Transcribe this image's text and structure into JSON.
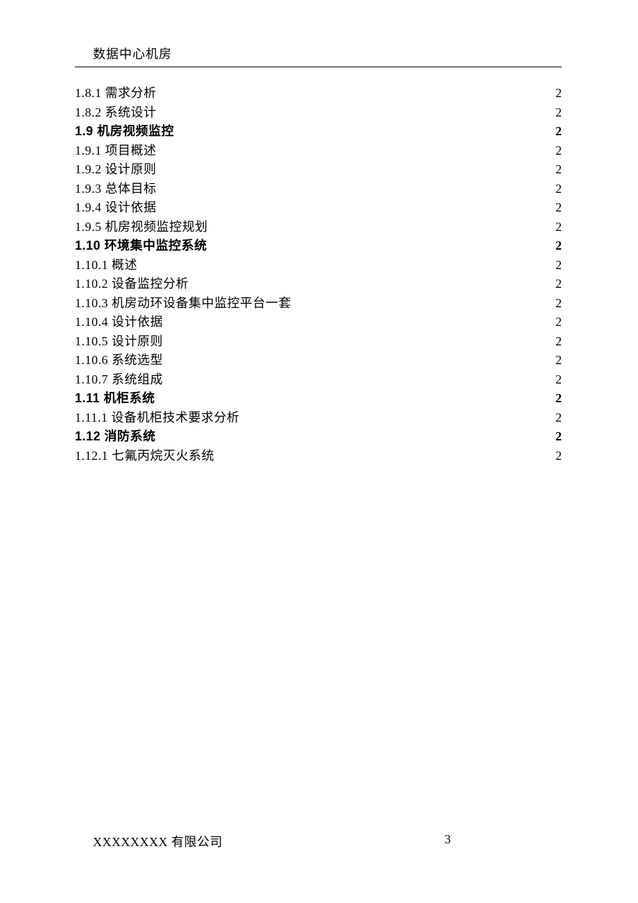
{
  "header": {
    "title": "数据中心机房"
  },
  "toc": {
    "items": [
      {
        "label": "1.8.1 需求分析",
        "page": "2",
        "bold": false
      },
      {
        "label": "1.8.2 系统设计",
        "page": "2",
        "bold": false
      },
      {
        "label": "1.9 机房视频监控",
        "page": "2",
        "bold": true
      },
      {
        "label": "1.9.1 项目概述",
        "page": "2",
        "bold": false
      },
      {
        "label": "1.9.2 设计原则",
        "page": "2",
        "bold": false
      },
      {
        "label": "1.9.3 总体目标",
        "page": "2",
        "bold": false
      },
      {
        "label": "1.9.4 设计依据",
        "page": "2",
        "bold": false
      },
      {
        "label": "1.9.5 机房视频监控规划",
        "page": "2",
        "bold": false
      },
      {
        "label": "1.10 环境集中监控系统",
        "page": "2",
        "bold": true
      },
      {
        "label": "1.10.1 概述",
        "page": "2",
        "bold": false
      },
      {
        "label": "1.10.2 设备监控分析",
        "page": "2",
        "bold": false
      },
      {
        "label": "1.10.3 机房动环设备集中监控平台一套",
        "page": "2",
        "bold": false
      },
      {
        "label": "1.10.4 设计依据",
        "page": "2",
        "bold": false
      },
      {
        "label": "1.10.5 设计原则",
        "page": "2",
        "bold": false
      },
      {
        "label": "1.10.6 系统选型",
        "page": "2",
        "bold": false
      },
      {
        "label": "1.10.7 系统组成",
        "page": "2",
        "bold": false
      },
      {
        "label": "1.11 机柜系统",
        "page": "2",
        "bold": true
      },
      {
        "label": "1.11.1 设备机柜技术要求分析",
        "page": "2",
        "bold": false
      },
      {
        "label": "1.12 消防系统",
        "page": "2",
        "bold": true
      },
      {
        "label": "1.12.1 七氟丙烷灭火系统",
        "page": "2",
        "bold": false
      }
    ]
  },
  "footer": {
    "company": "XXXXXXXX 有限公司",
    "page_number": "3"
  }
}
